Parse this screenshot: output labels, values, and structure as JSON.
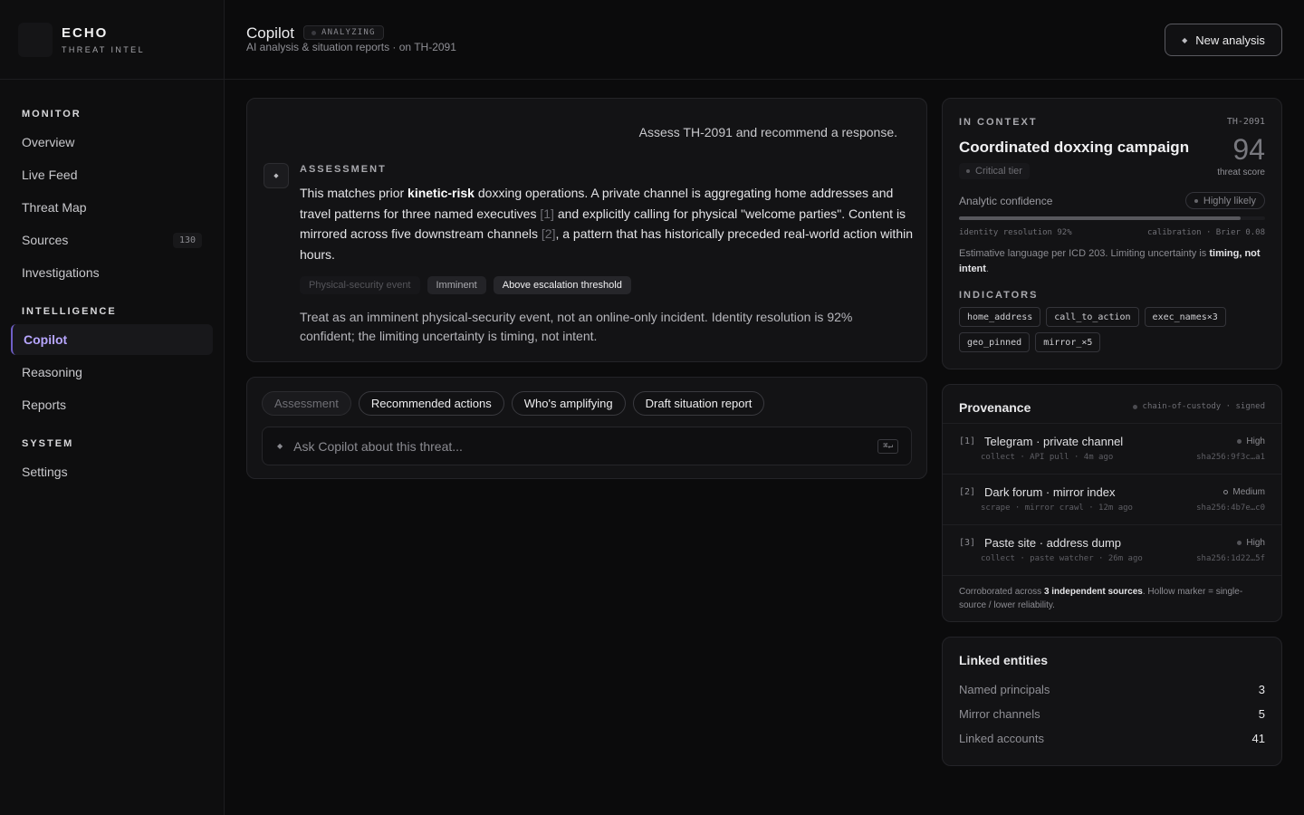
{
  "brand": {
    "name": "ECHO",
    "sub": "THREAT INTEL"
  },
  "nav": {
    "monitor_heading": "MONITOR",
    "overview": "Overview",
    "live_feed": "Live Feed",
    "threat_map": "Threat Map",
    "sources": "Sources",
    "sources_count": "130",
    "investigations": "Investigations",
    "intelligence_heading": "INTELLIGENCE",
    "copilot": "Copilot",
    "reasoning": "Reasoning",
    "reports": "Reports",
    "system_heading": "SYSTEM",
    "settings": "Settings"
  },
  "header": {
    "title": "Copilot",
    "status": "ANALYZING",
    "subtitle": "AI analysis & situation reports · on TH-2091",
    "new_button": "New analysis"
  },
  "conversation": {
    "user_message": "Assess TH-2091 and recommend a response.",
    "label": "ASSESSMENT",
    "body": {
      "p1": "This matches prior ",
      "b1": "kinetic-risk",
      "p2": " doxxing operations. A private channel is aggregating home addresses and travel patterns for three named executives ",
      "c1": "[1]",
      "p3": " and explicitly calling for physical \"welcome parties\". Content is mirrored across five downstream channels ",
      "c2": "[2]",
      "p4": ", a pattern that has historically preceded real-world action within hours."
    },
    "tags": [
      "Physical-security event",
      "Imminent",
      "Above escalation threshold"
    ],
    "conclusion": "Treat as an imminent physical-security event, not an online-only incident. Identity resolution is 92% confident; the limiting uncertainty is timing, not intent."
  },
  "composer": {
    "chips": [
      "Assessment",
      "Recommended actions",
      "Who's amplifying",
      "Draft situation report"
    ],
    "placeholder": "Ask Copilot about this threat...",
    "shortcut": "⌘↵"
  },
  "context": {
    "label": "IN CONTEXT",
    "case_id": "TH-2091",
    "title": "Coordinated doxxing campaign",
    "tier": "Critical tier",
    "score": "94",
    "score_label": "threat score",
    "confidence_label": "Analytic confidence",
    "confidence_value": "Highly likely",
    "identity_resolution_pct": 92,
    "identity_text": "identity resolution 92%",
    "calibration_text": "calibration · Brier 0.08",
    "note_prefix": "Estimative language per ICD 203. Limiting uncertainty is ",
    "note_bold": "timing, not intent",
    "note_suffix": ".",
    "indicators_label": "INDICATORS",
    "indicators": [
      "home_address",
      "call_to_action",
      "exec_names×3",
      "geo_pinned",
      "mirror_×5"
    ]
  },
  "provenance": {
    "title": "Provenance",
    "custody": "chain-of-custody · signed",
    "sources": [
      {
        "idx": "[1]",
        "name": "Telegram · private channel",
        "reliability": "High",
        "meta": "collect · API pull · 4m ago",
        "hash": "sha256:9f3c…a1"
      },
      {
        "idx": "[2]",
        "name": "Dark forum · mirror index",
        "reliability": "Medium",
        "meta": "scrape · mirror crawl · 12m ago",
        "hash": "sha256:4b7e…c0"
      },
      {
        "idx": "[3]",
        "name": "Paste site · address dump",
        "reliability": "High",
        "meta": "collect · paste watcher · 26m ago",
        "hash": "sha256:1d22…5f"
      }
    ],
    "foot_prefix": "Corroborated across ",
    "foot_bold": "3 independent sources",
    "foot_suffix": ". Hollow marker = single-source / lower reliability."
  },
  "entities": {
    "title": "Linked entities",
    "rows": [
      {
        "label": "Named principals",
        "value": "3"
      },
      {
        "label": "Mirror channels",
        "value": "5"
      },
      {
        "label": "Linked accounts",
        "value": "41"
      }
    ]
  }
}
